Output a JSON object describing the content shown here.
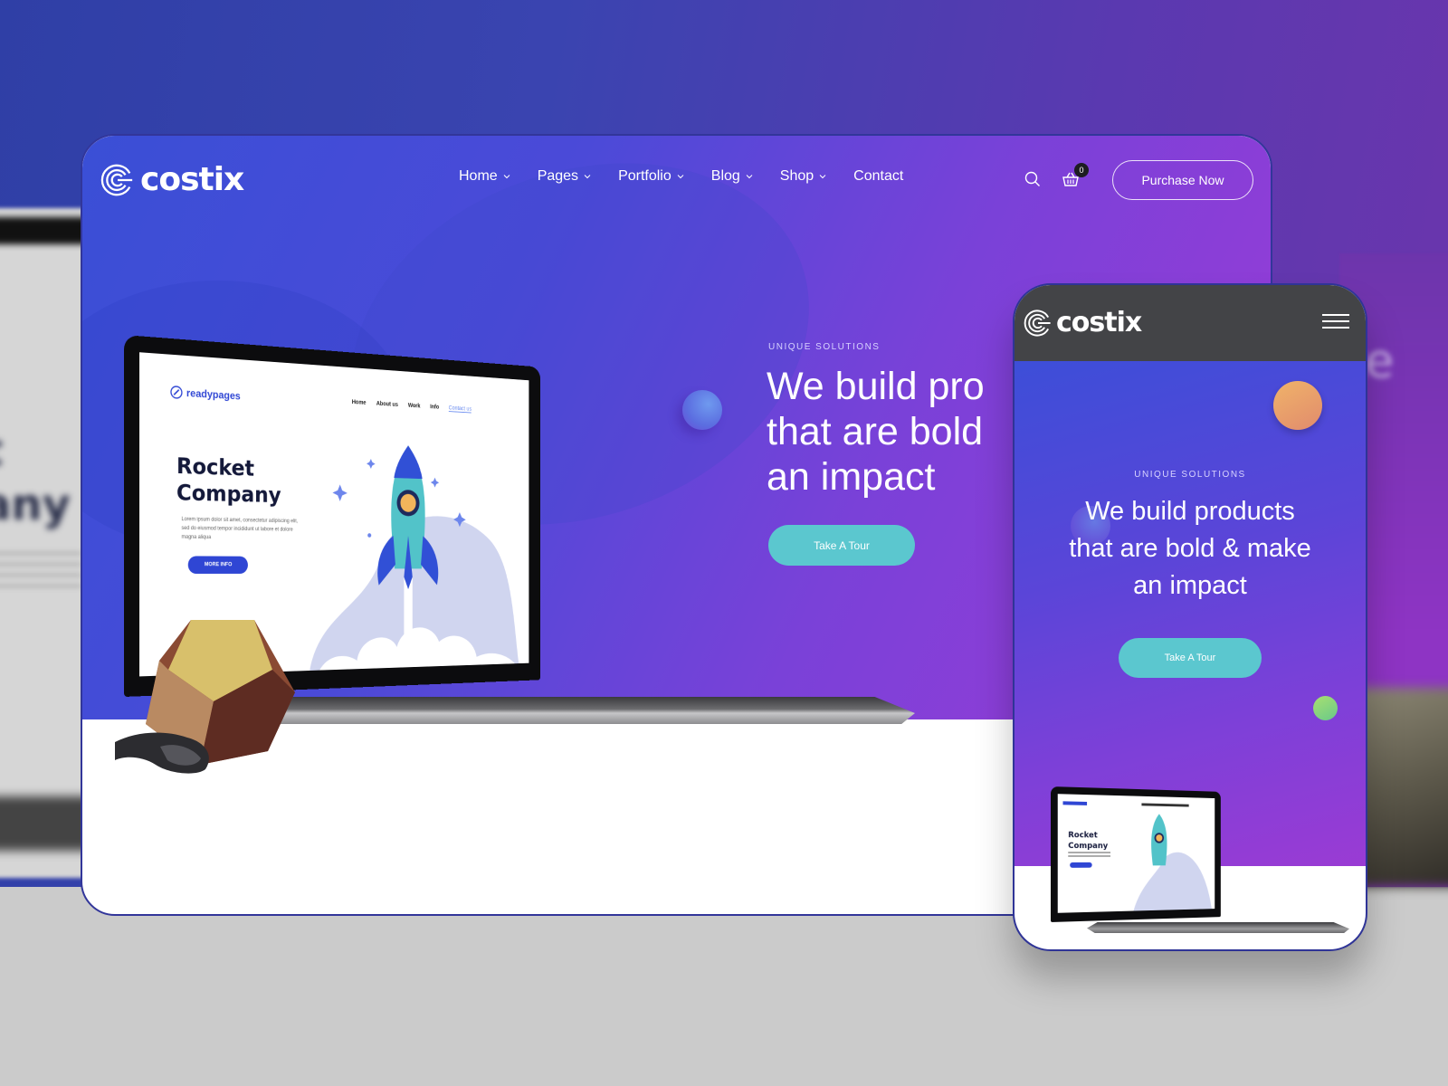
{
  "desktop": {
    "brand": "costix",
    "nav": [
      {
        "label": "Home",
        "has_dropdown": true
      },
      {
        "label": "Pages",
        "has_dropdown": true
      },
      {
        "label": "Portfolio",
        "has_dropdown": true
      },
      {
        "label": "Blog",
        "has_dropdown": true
      },
      {
        "label": "Shop",
        "has_dropdown": true
      },
      {
        "label": "Contact",
        "has_dropdown": false
      }
    ],
    "icons": {
      "search": "search-icon",
      "cart": "basket-icon"
    },
    "cart_count": "0",
    "purchase_label": "Purchase Now",
    "eyebrow": "UNIQUE SOLUTIONS",
    "headline_lines": [
      "We build pro",
      "that are bold",
      "an impact"
    ],
    "cta_label": "Take A Tour"
  },
  "laptop_screen": {
    "brand": "readypages",
    "nav": [
      "Home",
      "About us",
      "Work",
      "Info",
      "Contact us"
    ],
    "title_lines": [
      "Rocket",
      "Company"
    ],
    "body": "Lorem ipsum dolor sit amet, consectetur adipiscing elit, sed do eiusmod tempor incididunt ut labore et dolore magna aliqua",
    "button": "MORE INFO"
  },
  "phone": {
    "brand": "costix",
    "menu_icon": "hamburger-icon",
    "eyebrow": "UNIQUE SOLUTIONS",
    "headline_lines": [
      "We build products",
      "that are bold & make",
      "an impact"
    ],
    "cta_label": "Take A Tour"
  },
  "background": {
    "blurred_text_left": [
      "t",
      "any"
    ],
    "blurred_text_right": "ke"
  },
  "colors": {
    "accent_teal": "#5bc7cf",
    "hero_start": "#3a4fd6",
    "hero_end": "#9c3bd6",
    "phone_header": "#434447",
    "border_navy": "#32369a",
    "readypages_blue": "#2f46d4"
  }
}
